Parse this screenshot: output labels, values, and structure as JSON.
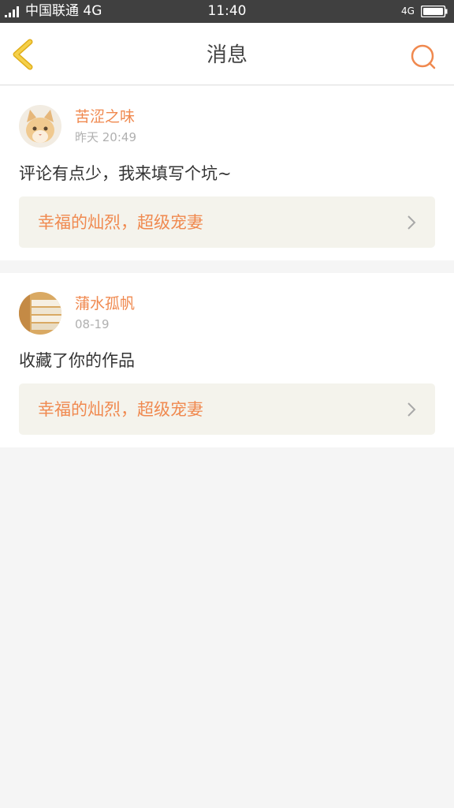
{
  "status_bar": {
    "carrier": "中国联通 4G",
    "time": "11:40",
    "network": "4G"
  },
  "header": {
    "title": "消息",
    "back_icon": "chevron-left-icon",
    "search_icon": "search-icon",
    "accent_color": "#f5d04a",
    "search_color": "#f0894f"
  },
  "messages": [
    {
      "username": "苦涩之味",
      "time": "昨天 20:49",
      "text": "评论有点少，我来填写个坑~",
      "work_title": "幸福的灿烈，超级宠妻",
      "avatar": "cat-avatar"
    },
    {
      "username": "蒲水孤帆",
      "time": "08-19",
      "text": "收藏了你的作品",
      "work_title": "幸福的灿烈，超级宠妻",
      "avatar": "books-avatar"
    }
  ],
  "colors": {
    "accent_orange": "#f0894f",
    "link_background": "#f4f3ec",
    "page_background": "#f5f5f5"
  }
}
